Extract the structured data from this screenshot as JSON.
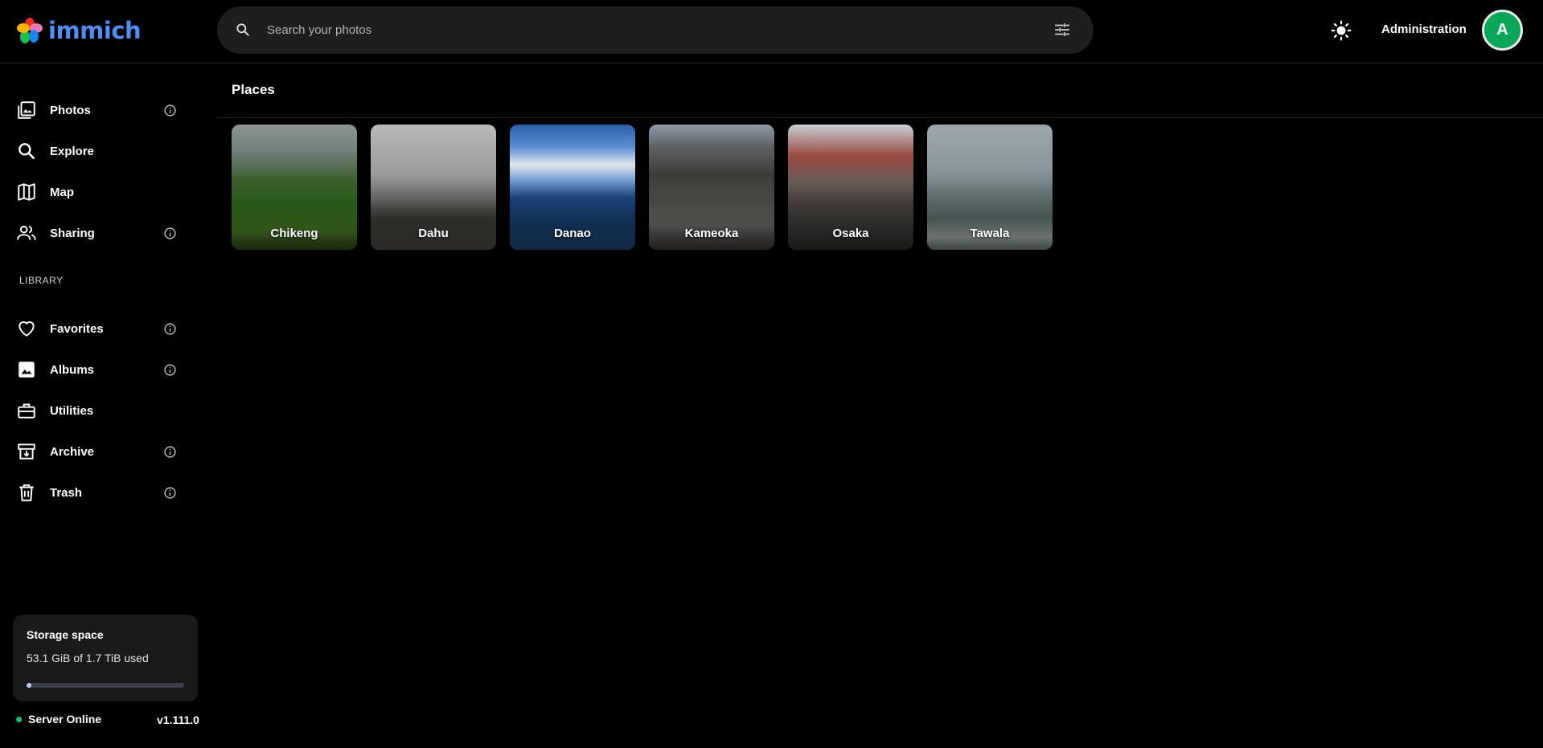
{
  "app": {
    "name": "immich"
  },
  "search": {
    "placeholder": "Search your photos"
  },
  "header": {
    "admin_label": "Administration",
    "avatar_initial": "A"
  },
  "sidebar": {
    "items": [
      {
        "label": "Photos",
        "icon": "photos-icon",
        "info": true
      },
      {
        "label": "Explore",
        "icon": "search-icon",
        "info": false
      },
      {
        "label": "Map",
        "icon": "map-icon",
        "info": false
      },
      {
        "label": "Sharing",
        "icon": "sharing-icon",
        "info": true
      }
    ],
    "library_label": "LIBRARY",
    "library_items": [
      {
        "label": "Favorites",
        "icon": "heart-icon",
        "info": true
      },
      {
        "label": "Albums",
        "icon": "albums-icon",
        "info": true
      },
      {
        "label": "Utilities",
        "icon": "toolbox-icon",
        "info": false
      },
      {
        "label": "Archive",
        "icon": "archive-icon",
        "info": true
      },
      {
        "label": "Trash",
        "icon": "trash-icon",
        "info": true
      }
    ]
  },
  "storage": {
    "title": "Storage space",
    "used_text": "53.1 GiB of 1.7 TiB used",
    "used_fraction": 0.03
  },
  "server": {
    "status": "Server Online",
    "version": "v1.111.0",
    "status_color": "#19c26a"
  },
  "main": {
    "title": "Places",
    "places": [
      "Chikeng",
      "Dahu",
      "Danao",
      "Kameoka",
      "Osaka",
      "Tawala"
    ]
  },
  "colors": {
    "accent": "#4e8ef5",
    "avatar": "#0aa75a"
  }
}
